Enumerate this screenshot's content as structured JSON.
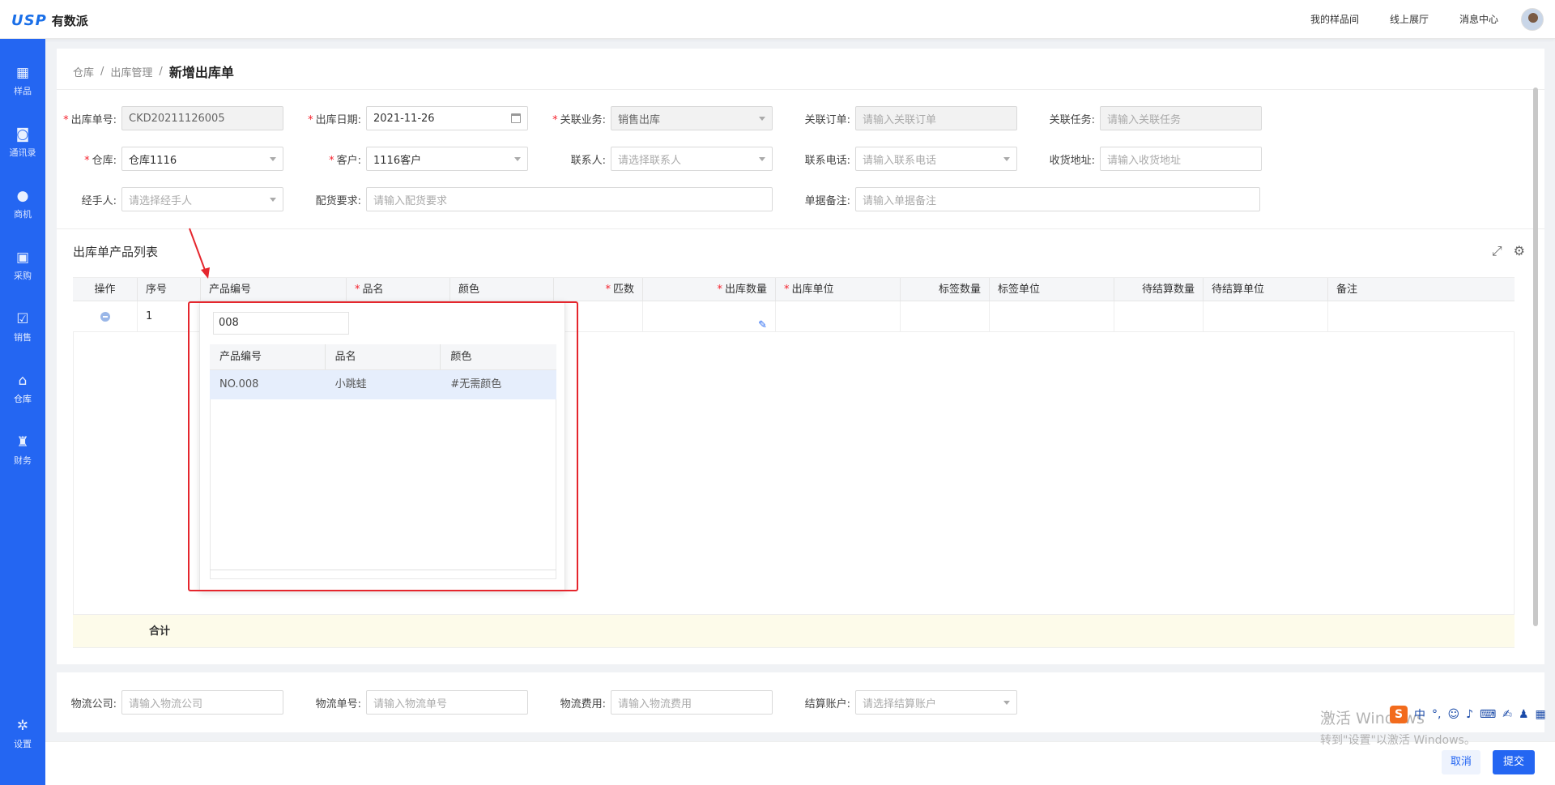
{
  "app": {
    "logo_mark": "USP",
    "logo_name": "有数派"
  },
  "topnav": [
    "我的样品间",
    "线上展厅",
    "消息中心"
  ],
  "sidebar": [
    {
      "label": "样品",
      "icon": "sample-icon"
    },
    {
      "label": "通讯录",
      "icon": "contacts-icon"
    },
    {
      "label": "商机",
      "icon": "opportunity-icon"
    },
    {
      "label": "采购",
      "icon": "purchase-icon"
    },
    {
      "label": "销售",
      "icon": "sales-icon"
    },
    {
      "label": "仓库",
      "icon": "warehouse-icon"
    },
    {
      "label": "财务",
      "icon": "finance-icon"
    },
    {
      "label": "设置",
      "icon": "settings-icon"
    }
  ],
  "breadcrumb": {
    "l1": "仓库",
    "sep": "/",
    "l2": "出库管理",
    "current": "新增出库单"
  },
  "form": {
    "order_no": {
      "label": "出库单号:",
      "value": "CKD20211126005"
    },
    "date": {
      "label": "出库日期:",
      "value": "2021-11-26"
    },
    "biz": {
      "label": "关联业务:",
      "value": "销售出库"
    },
    "order": {
      "label": "关联订单:",
      "placeholder": "请输入关联订单"
    },
    "task": {
      "label": "关联任务:",
      "placeholder": "请输入关联任务"
    },
    "warehouse": {
      "label": "仓库:",
      "value": "仓库1116"
    },
    "customer": {
      "label": "客户:",
      "value": "1116客户"
    },
    "contact": {
      "label": "联系人:",
      "placeholder": "请选择联系人"
    },
    "phone": {
      "label": "联系电话:",
      "placeholder": "请输入联系电话"
    },
    "address": {
      "label": "收货地址:",
      "placeholder": "请输入收货地址"
    },
    "handler": {
      "label": "经手人:",
      "placeholder": "请选择经手人"
    },
    "delivery": {
      "label": "配货要求:",
      "placeholder": "请输入配货要求"
    },
    "remark": {
      "label": "单据备注:",
      "placeholder": "请输入单据备注"
    }
  },
  "table": {
    "title": "出库单产品列表",
    "columns": [
      "操作",
      "序号",
      "产品编号",
      "品名",
      "颜色",
      "匹数",
      "出库数量",
      "出库单位",
      "标签数量",
      "标签单位",
      "待结算数量",
      "待结算单位",
      "备注"
    ],
    "row": {
      "index": "1"
    },
    "footer_sum": "合计"
  },
  "dropdown": {
    "query": "008",
    "columns": [
      "产品编号",
      "品名",
      "颜色"
    ],
    "rows": [
      {
        "code": "NO.008",
        "name": "小跳蛙",
        "color": "#无需颜色"
      }
    ]
  },
  "bottom": {
    "logistics_company": {
      "label": "物流公司:",
      "placeholder": "请输入物流公司"
    },
    "logistics_no": {
      "label": "物流单号:",
      "placeholder": "请输入物流单号"
    },
    "logistics_fee": {
      "label": "物流费用:",
      "placeholder": "请输入物流费用"
    },
    "account": {
      "label": "结算账户:",
      "placeholder": "请选择结算账户"
    }
  },
  "buttons": {
    "cancel": "取消",
    "submit": "提交"
  },
  "watermark": {
    "line1": "激活 Windows",
    "line2": "转到\"设置\"以激活 Windows。"
  },
  "ime": {
    "logo": "S",
    "lang": "中"
  },
  "colors": {
    "primary": "#2466f2",
    "annotation": "#e5262d",
    "footer_bg": "#fdfbea"
  }
}
